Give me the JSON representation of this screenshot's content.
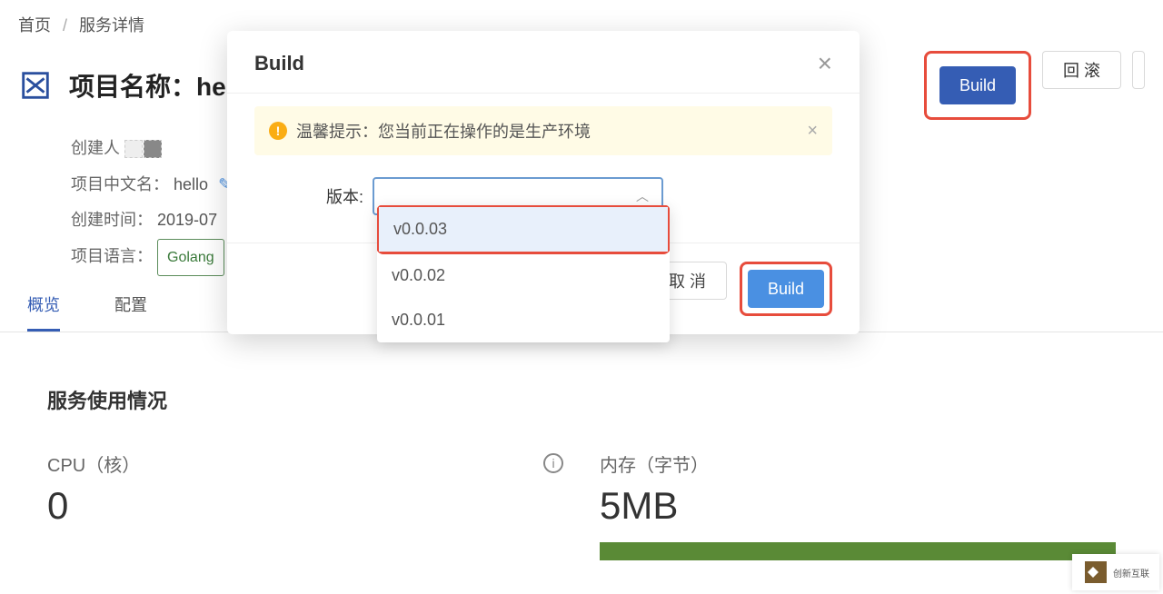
{
  "breadcrumb": {
    "home": "首页",
    "detail": "服务详情"
  },
  "header": {
    "title_prefix": "项目名称：",
    "project_name": "hel",
    "build_btn": "Build",
    "rollback_btn": "回 滚"
  },
  "details": {
    "creator_label": "创建人",
    "cn_name_label": "项目中文名：",
    "cn_name_value": "hello",
    "created_label": "创建时间：",
    "created_value": "2019-07",
    "lang_label": "项目语言：",
    "lang_value": "Golang"
  },
  "tabs": {
    "overview": "概览",
    "config": "配置"
  },
  "panel": {
    "title": "服务使用情况"
  },
  "stats": {
    "cpu_label": "CPU（核）",
    "cpu_value": "0",
    "mem_label": "内存（字节）",
    "mem_value": "5MB"
  },
  "modal": {
    "title": "Build",
    "alert": "温馨提示：您当前正在操作的是生产环境",
    "version_label": "版本:",
    "cancel": "取 消",
    "build": "Build",
    "options": [
      "v0.0.03",
      "v0.0.02",
      "v0.0.01"
    ]
  },
  "watermark": "创新互联"
}
